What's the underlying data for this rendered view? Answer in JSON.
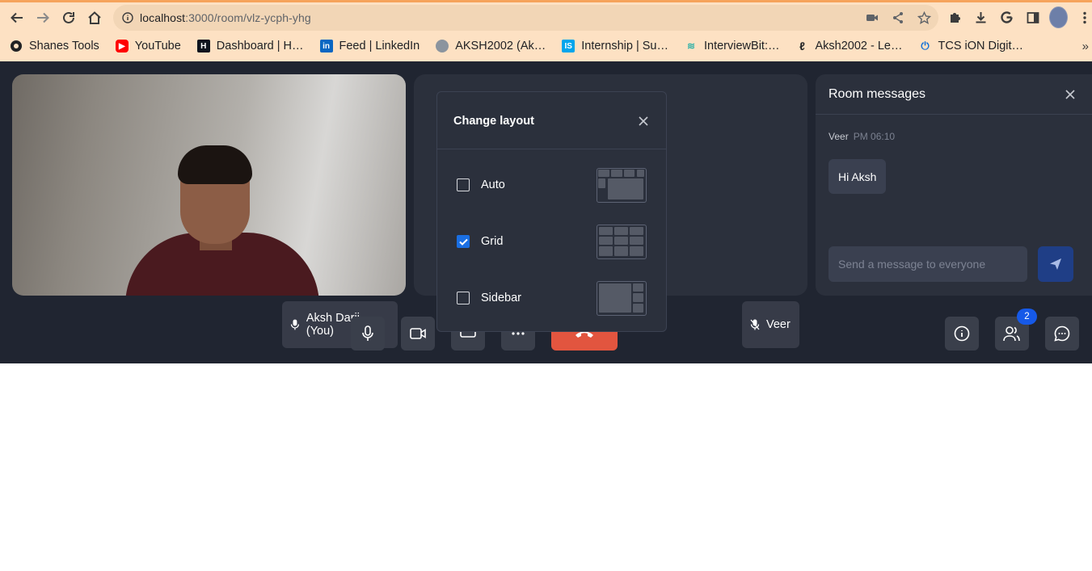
{
  "browser": {
    "url_host": "localhost",
    "url_path": ":3000/room/vlz-ycph-yhg",
    "bookmarks": [
      {
        "label": "Shanes Tools",
        "icon": "shanes-tools-icon",
        "color": "#202124"
      },
      {
        "label": "YouTube",
        "icon": "youtube-icon",
        "color": "#ff0000"
      },
      {
        "label": "Dashboard | H…",
        "icon": "hackerrank-icon",
        "color": "#0e141e"
      },
      {
        "label": "Feed | LinkedIn",
        "icon": "linkedin-icon",
        "color": "#0a66c2"
      },
      {
        "label": "AKSH2002 (Ak…",
        "icon": "github-icon",
        "color": "#6e7681"
      },
      {
        "label": "Internship | Su…",
        "icon": "internshala-icon",
        "color": "#00a5ec"
      },
      {
        "label": "InterviewBit:…",
        "icon": "interviewbit-icon",
        "color": "#39b3a8"
      },
      {
        "label": "Aksh2002 - Le…",
        "icon": "leetcode-icon",
        "color": "#ffa116"
      },
      {
        "label": "TCS iON Digit…",
        "icon": "tcs-ion-icon",
        "color": "#0f6fd8"
      }
    ],
    "more_label": "»"
  },
  "tiles": {
    "self_name": "Aksh Darji (You)",
    "veer_name": "Veer"
  },
  "chat": {
    "title": "Room messages",
    "messages": [
      {
        "sender": "Veer",
        "time": "PM 06:10",
        "text": "Hi Aksh"
      }
    ],
    "input_placeholder": "Send a message to everyone"
  },
  "controls": {
    "participants_count": "2"
  },
  "layout_modal": {
    "title": "Change layout",
    "options": [
      {
        "label": "Auto",
        "checked": false
      },
      {
        "label": "Grid",
        "checked": true
      },
      {
        "label": "Sidebar",
        "checked": false
      }
    ]
  },
  "colors": {
    "app_bg": "#202531",
    "panel_bg": "#2b303c",
    "accent": "#1a6fe3",
    "leave_red": "#e2553f",
    "browser_tint": "#fde1c3"
  }
}
